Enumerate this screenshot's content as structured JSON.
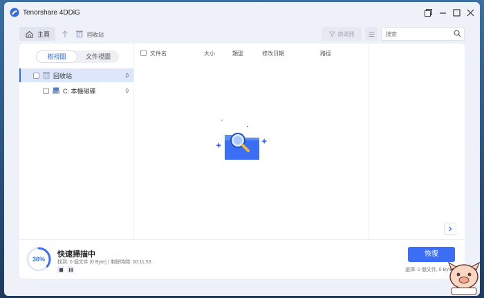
{
  "app": {
    "title": "Tenorshare 4DDiG"
  },
  "window_controls": {
    "restore": "⧉",
    "minimize": "—",
    "maximize": "☐",
    "close": "✕"
  },
  "toolbar": {
    "home_label": "主頁",
    "breadcrumb": "回收站",
    "filter_label": "篩選器",
    "search_placeholder": "搜索"
  },
  "left_pane": {
    "tabs": [
      {
        "label": "樹視圖"
      },
      {
        "label": "文件視圖"
      }
    ],
    "tree": [
      {
        "label": "回收站",
        "count": "0"
      },
      {
        "label": "C: 本機磁碟",
        "count": "0"
      }
    ]
  },
  "file_list": {
    "columns": [
      "文件名",
      "大小",
      "類型",
      "修改日期",
      "路徑"
    ]
  },
  "footer": {
    "progress": 0.36,
    "progress_label": "36%",
    "scan_title": "快速掃描中",
    "scan_stats": "找到: 0 個文件 (0 Byte) /  剩餘時間: 00:11:53",
    "recover_label": "恢復",
    "selected_stats": "選擇: 0 個文件, 0 Byte"
  },
  "colors": {
    "accent": "#3b6ef5",
    "selected_row": "#dde6fb",
    "window_bg": "#eef1f8",
    "panel_bg": "#ffffff"
  },
  "icons": {
    "app_logo": "tenorshare-logo-icon",
    "home": "home-icon",
    "up": "arrow-up-icon",
    "breadcrumb": "recycle-bin-icon",
    "filter": "funnel-icon",
    "list": "list-icon",
    "search": "search-icon",
    "next": "chevron-right-icon",
    "empty_state": "folder-search-icon",
    "stop": "stop-icon",
    "pause": "pause-icon"
  }
}
